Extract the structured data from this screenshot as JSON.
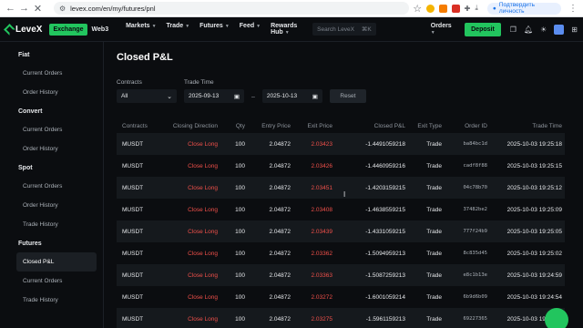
{
  "browser": {
    "url": "levex.com/en/my/futures/pnl",
    "profile_label": "Подтвердить личность",
    "notif_count": "6"
  },
  "header": {
    "logo": "LeveX",
    "exchange_label": "Exchange",
    "web3_label": "Web3",
    "menu": [
      "Markets",
      "Trade",
      "Futures",
      "Feed",
      "Rewards Hub"
    ],
    "search_placeholder": "Search LeveX",
    "search_shortcut": "⌘K",
    "orders_label": "Orders",
    "deposit_label": "Deposit",
    "accent": "#22c55e"
  },
  "sidebar": {
    "groups": [
      {
        "label": "Fiat",
        "items": [
          "Current Orders",
          "Order History"
        ]
      },
      {
        "label": "Convert",
        "items": [
          "Current Orders",
          "Order History"
        ]
      },
      {
        "label": "Spot",
        "items": [
          "Current Orders",
          "Order History",
          "Trade History"
        ]
      },
      {
        "label": "Futures",
        "items": [
          "Closed P&L",
          "Current Orders",
          "Trade History"
        ]
      }
    ],
    "active": "Closed P&L"
  },
  "page": {
    "title": "Closed P&L",
    "filters": {
      "contracts_label": "Contracts",
      "contracts_value": "All",
      "trade_time_label": "Trade Time",
      "date_from": "2025-09-13",
      "date_to": "2025-10-13",
      "reset_label": "Reset"
    }
  },
  "table": {
    "columns": [
      "Contracts",
      "Closing Direction",
      "Qty",
      "Entry Price",
      "Exit Price",
      "Closed P&L",
      "Exit Type",
      "Order ID",
      "Trade Time"
    ],
    "rows": [
      [
        "MUSDT",
        "Close Long",
        "100",
        "2.04872",
        "2.03423",
        "-1.4491059218",
        "Trade",
        "ba84bc1d",
        "2025-10-03 19:25:18"
      ],
      [
        "MUSDT",
        "Close Long",
        "100",
        "2.04872",
        "2.03426",
        "-1.4460959216",
        "Trade",
        "cadf8f88",
        "2025-10-03 19:25:15"
      ],
      [
        "MUSDT",
        "Close Long",
        "100",
        "2.04872",
        "2.03451",
        "-1.4203159215",
        "Trade",
        "04c78b70",
        "2025-10-03 19:25:12"
      ],
      [
        "MUSDT",
        "Close Long",
        "100",
        "2.04872",
        "2.03408",
        "-1.4638559215",
        "Trade",
        "37482be2",
        "2025-10-03 19:25:09"
      ],
      [
        "MUSDT",
        "Close Long",
        "100",
        "2.04872",
        "2.03439",
        "-1.4331059215",
        "Trade",
        "777f24b9",
        "2025-10-03 19:25:05"
      ],
      [
        "MUSDT",
        "Close Long",
        "100",
        "2.04872",
        "2.03362",
        "-1.5094959213",
        "Trade",
        "8c835d45",
        "2025-10-03 19:25:02"
      ],
      [
        "MUSDT",
        "Close Long",
        "100",
        "2.04872",
        "2.03363",
        "-1.5087259213",
        "Trade",
        "e8c1b13e",
        "2025-10-03 19:24:59"
      ],
      [
        "MUSDT",
        "Close Long",
        "100",
        "2.04872",
        "2.03272",
        "-1.6001059214",
        "Trade",
        "6b9d6b09",
        "2025-10-03 19:24:54"
      ],
      [
        "MUSDT",
        "Close Long",
        "100",
        "2.04872",
        "2.03275",
        "-1.5961159213",
        "Trade",
        "69227365",
        "2025-10-03 19:24:50"
      ]
    ]
  }
}
